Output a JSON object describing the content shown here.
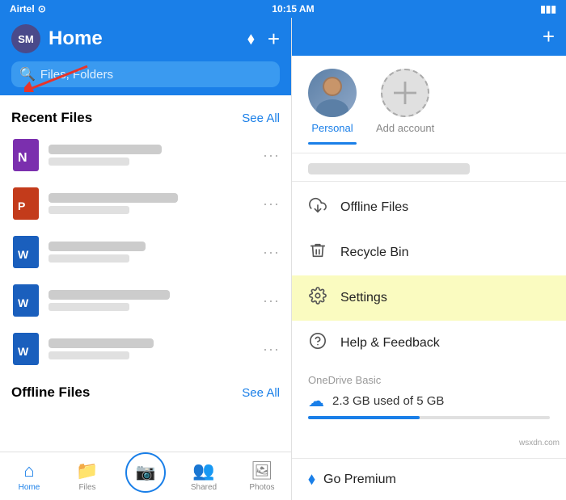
{
  "statusBar": {
    "carrier": "Airtel",
    "time": "10:15 AM",
    "battery": "Full"
  },
  "header": {
    "avatarInitials": "SM",
    "title": "Home",
    "plusLabel": "+"
  },
  "search": {
    "placeholder": "Files, Folders"
  },
  "recentFiles": {
    "sectionTitle": "Recent Files",
    "seeAll": "See All",
    "files": [
      {
        "type": "onenote",
        "color": "#7B2FAE"
      },
      {
        "type": "powerpoint",
        "color": "#C33B1B"
      },
      {
        "type": "word",
        "color": "#1a5fbd"
      },
      {
        "type": "word",
        "color": "#1a5fbd"
      },
      {
        "type": "word",
        "color": "#1a5fbd"
      }
    ]
  },
  "offlineFiles": {
    "sectionTitle": "Offline Files",
    "seeAll": "See All"
  },
  "tabs": {
    "items": [
      {
        "label": "Home",
        "active": true
      },
      {
        "label": "Files"
      },
      {
        "label": ""
      },
      {
        "label": "Shared"
      },
      {
        "label": "Photos"
      }
    ]
  },
  "dropdown": {
    "accounts": [
      {
        "label": "Personal",
        "active": true
      },
      {
        "label": "Add account",
        "isAdd": true
      }
    ],
    "menuItems": [
      {
        "label": "Offline Files",
        "icon": "cloud-down"
      },
      {
        "label": "Recycle Bin",
        "icon": "trash"
      },
      {
        "label": "Settings",
        "icon": "gear",
        "highlighted": true
      },
      {
        "label": "Help & Feedback",
        "icon": "help"
      }
    ],
    "storagePlan": "OneDrive Basic",
    "storageText": "2.3 GB used of 5 GB",
    "storagePercent": 46,
    "goPremium": "Go Premium"
  },
  "watermark": "wsxdn.com"
}
